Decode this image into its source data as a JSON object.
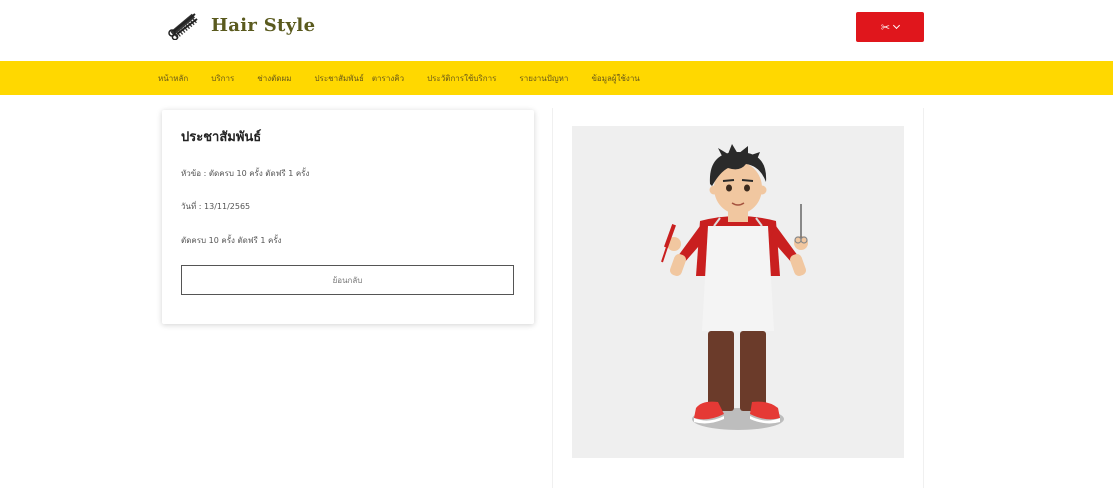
{
  "header": {
    "brand_name": "Hair Style",
    "logo_icon": "scissors-comb-icon",
    "user_menu": {
      "icon": "scissors-icon",
      "color": "#e0161c"
    }
  },
  "nav": {
    "background": "#ffd800",
    "items": [
      "หน้าหลัก",
      "บริการ",
      "ช่างตัดผม",
      "ประชาสัมพันธ์",
      "ตารางคิว",
      "ประวัติการใช้บริการ",
      "รายงานปัญหา",
      "ข้อมูลผู้ใช้งาน"
    ]
  },
  "announcement": {
    "title": "ประชาสัมพันธ์",
    "subject_line": "หัวข้อ : ตัดครบ 10 ครั้ง ตัดฟรี 1 ครั้ง",
    "date_line": "วันที่ : 13/11/2565",
    "detail": "ตัดครบ 10 ครั้ง ตัดฟรี 1 ครั้ง",
    "back_button": "ย้อนกลับ"
  },
  "illustration": {
    "subject": "barber-character-illustration"
  }
}
